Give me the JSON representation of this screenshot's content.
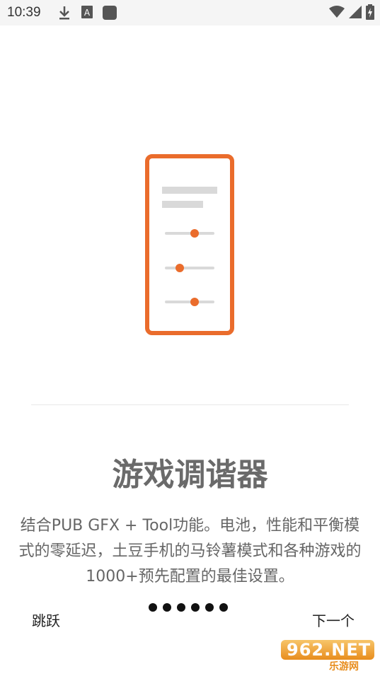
{
  "status_bar": {
    "time": "10:39",
    "left_icons": [
      "download-icon",
      "font-a-icon",
      "app-square-icon"
    ],
    "right_icons": [
      "wifi-icon",
      "signal-icon",
      "battery-icon"
    ]
  },
  "onboarding": {
    "title": "游戏调谐器",
    "description": "结合PUB GFX + Tool功能。电池，性能和平衡模式的零延迟，土豆手机的马铃薯模式和各种游戏的1000+预先配置的最佳设置。",
    "skip_label": "跳跃",
    "next_label": "下一个",
    "page_count": 6
  },
  "watermark": {
    "brand": "962",
    "suffix": ".NET",
    "sub": "乐游网"
  },
  "colors": {
    "accent": "#ea6c2c",
    "title": "#6a6a6a",
    "text": "#666666",
    "status_bg": "#f5f5f5"
  }
}
